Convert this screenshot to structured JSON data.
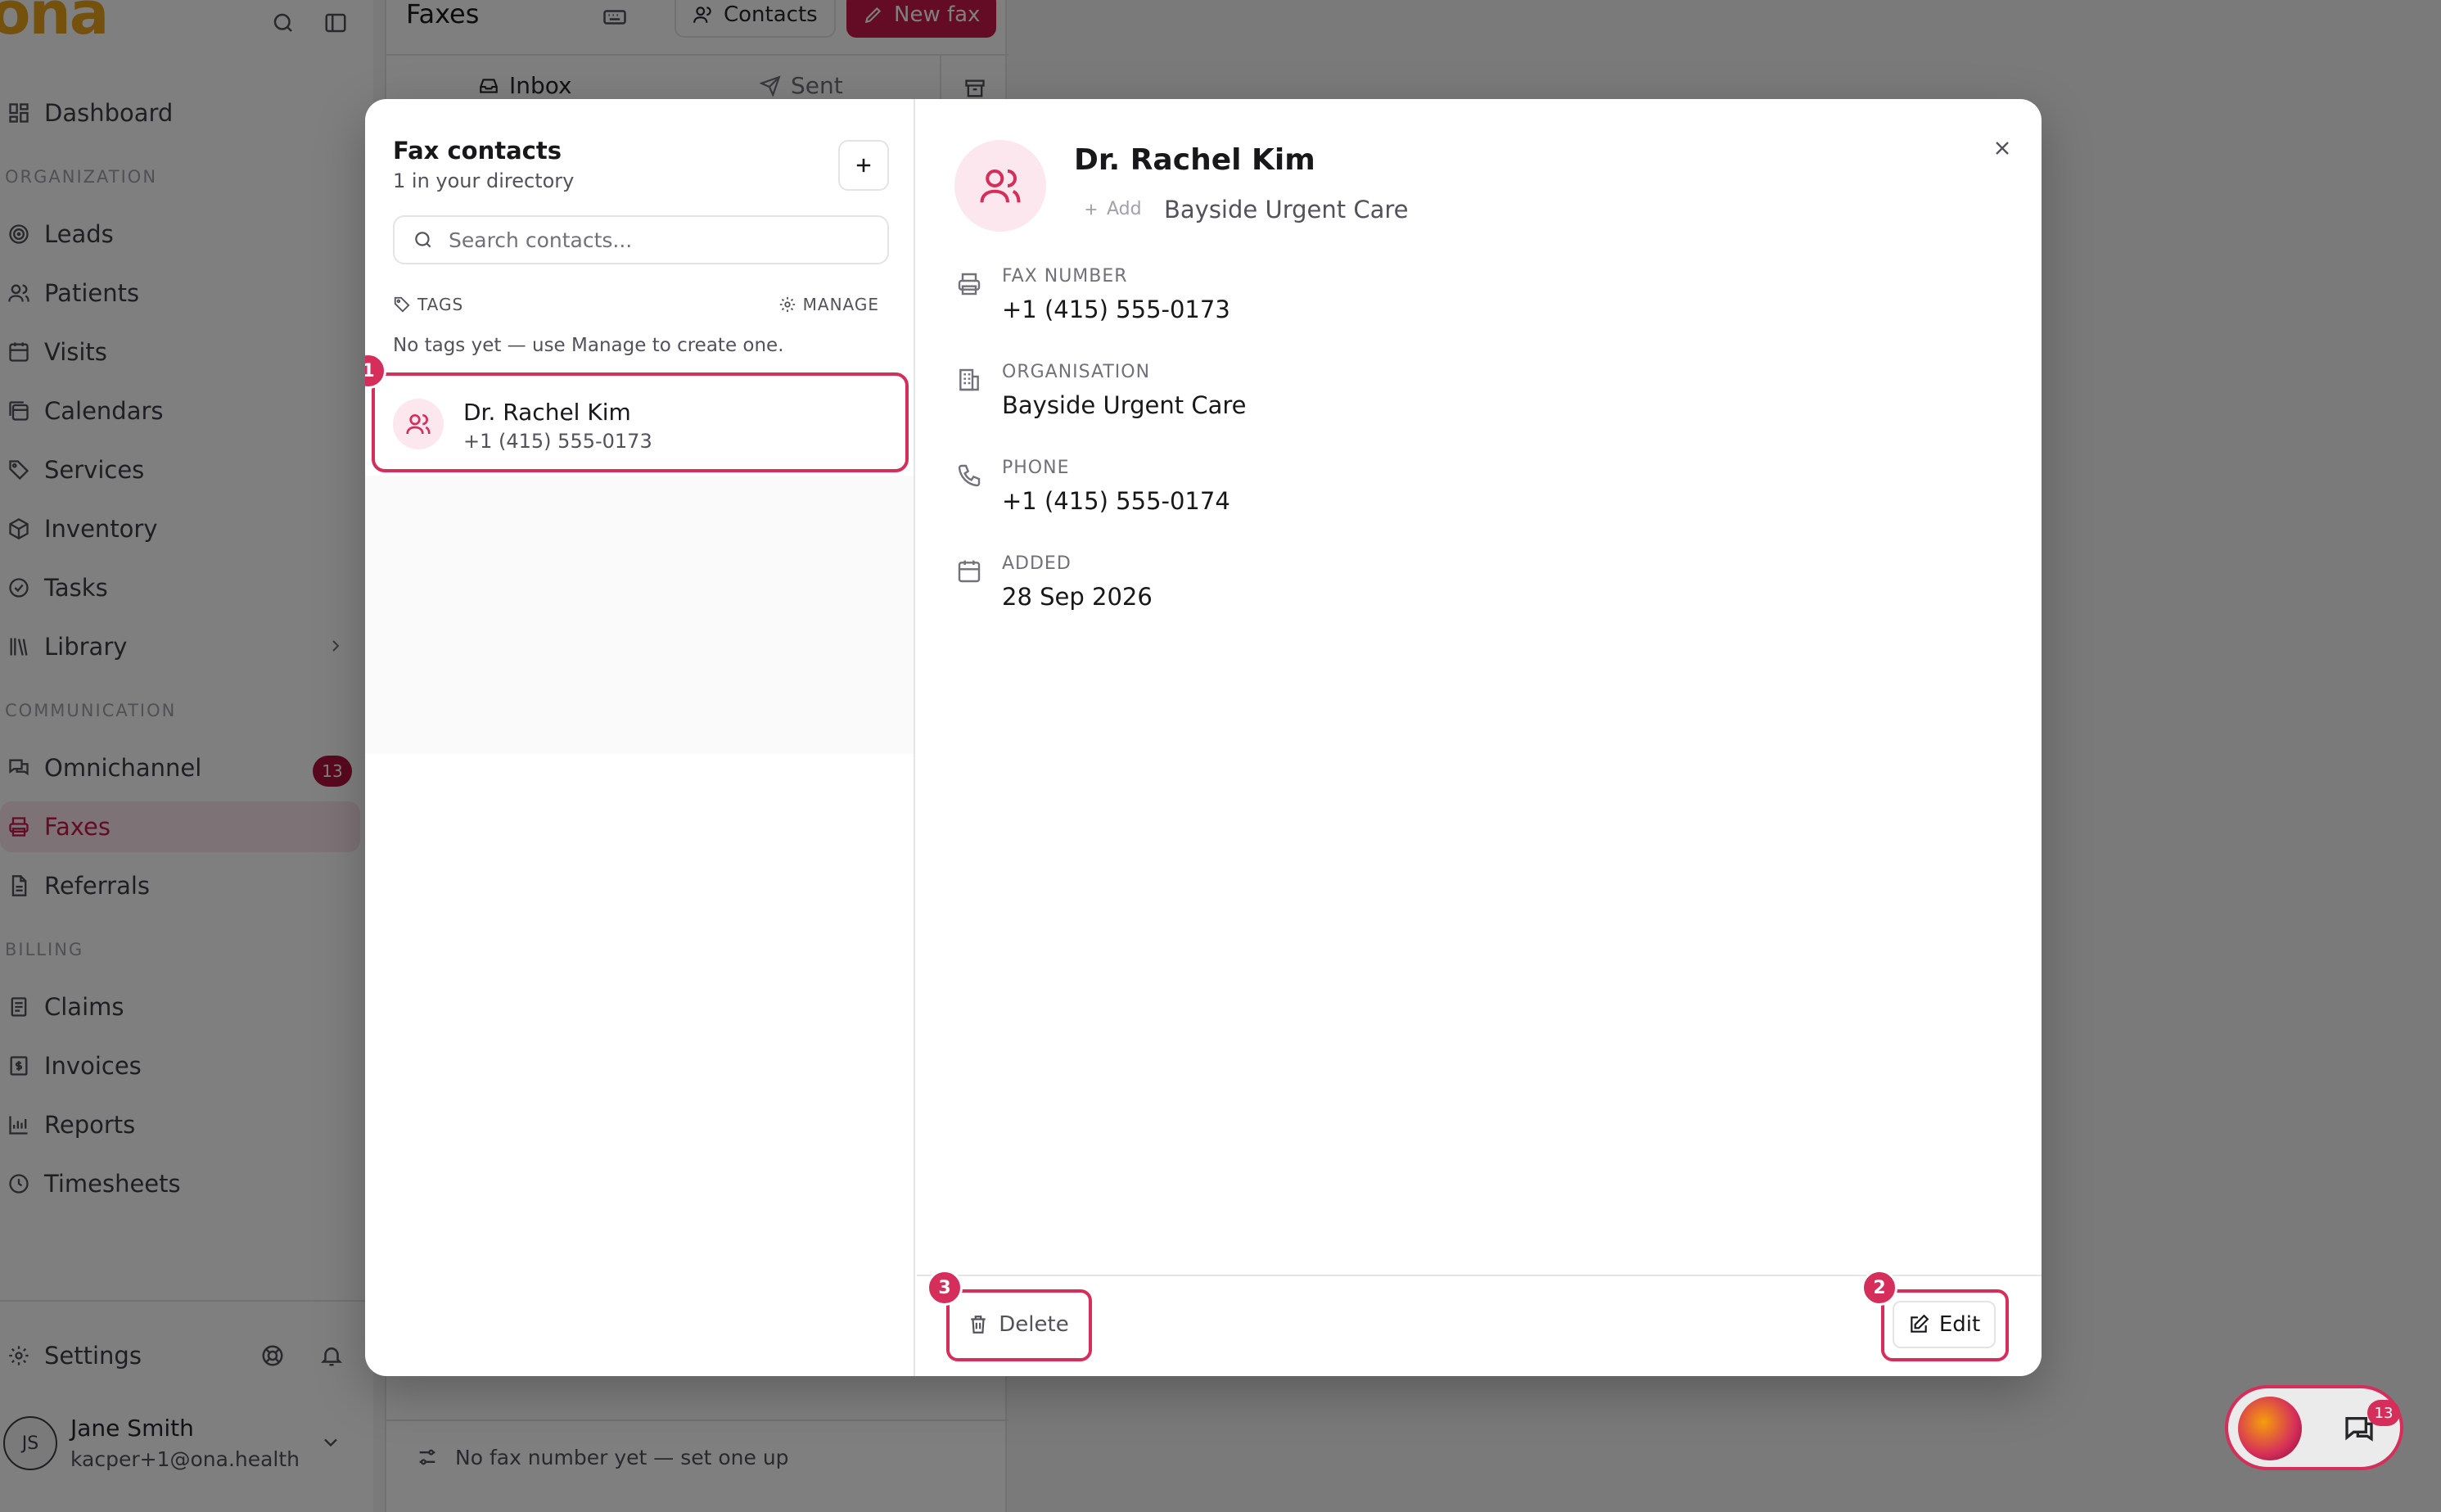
{
  "app": {
    "logo_text": "ona",
    "brand_color": "#c8184a",
    "logo_color": "#e8a21b"
  },
  "sidebar": {
    "top_nav": [
      {
        "id": "dashboard",
        "label": "Dashboard",
        "icon": "grid-icon"
      }
    ],
    "sections": [
      {
        "title": "ORGANIZATION",
        "items": [
          {
            "label": "Leads",
            "icon": "target-icon"
          },
          {
            "label": "Patients",
            "icon": "users-icon"
          },
          {
            "label": "Visits",
            "icon": "calendar-grid-icon"
          },
          {
            "label": "Calendars",
            "icon": "calendars-icon"
          },
          {
            "label": "Services",
            "icon": "tag-icon"
          },
          {
            "label": "Inventory",
            "icon": "box-icon"
          },
          {
            "label": "Tasks",
            "icon": "check-circle-icon"
          },
          {
            "label": "Library",
            "icon": "library-icon"
          }
        ]
      },
      {
        "title": "COMMUNICATION",
        "items": [
          {
            "label": "Omnichannel",
            "icon": "messages-icon",
            "badge": "13"
          },
          {
            "label": "Faxes",
            "icon": "printer-icon",
            "active": true
          },
          {
            "label": "Referrals",
            "icon": "document-icon"
          }
        ]
      },
      {
        "title": "BILLING",
        "items": [
          {
            "label": "Claims",
            "icon": "file-list-icon"
          },
          {
            "label": "Invoices",
            "icon": "invoice-icon"
          },
          {
            "label": "Reports",
            "icon": "chart-icon"
          },
          {
            "label": "Timesheets",
            "icon": "clock-icon"
          }
        ]
      }
    ],
    "settings_label": "Settings",
    "user": {
      "initials": "JS",
      "name": "Jane Smith",
      "email": "kacper+1@ona.health"
    }
  },
  "fax_page": {
    "title": "Faxes",
    "contacts_button": "Contacts",
    "new_fax_button": "New fax",
    "tabs": [
      {
        "label": "Inbox"
      },
      {
        "label": "Sent"
      }
    ],
    "footer_text": "No fax number yet — set one up"
  },
  "modal": {
    "title": "Fax contacts",
    "subtitle": "1 in your directory",
    "search_placeholder": "Search contacts...",
    "tags_label": "TAGS",
    "manage_label": "MANAGE",
    "empty_tags": "No tags yet — use Manage to create one.",
    "contacts": [
      {
        "name": "Dr. Rachel Kim",
        "phone": "+1 (415) 555-0173"
      }
    ],
    "detail": {
      "name": "Dr. Rachel Kim",
      "add_label": "Add",
      "organisation_tag": "Bayside Urgent Care",
      "fields": [
        {
          "label": "FAX NUMBER",
          "value": "+1 (415) 555-0173",
          "icon": "printer-icon"
        },
        {
          "label": "ORGANISATION",
          "value": "Bayside Urgent Care",
          "icon": "building-icon"
        },
        {
          "label": "PHONE",
          "value": "+1 (415) 555-0174",
          "icon": "phone-icon"
        },
        {
          "label": "ADDED",
          "value": "28 Sep 2026",
          "icon": "calendar-icon"
        }
      ],
      "delete_label": "Delete",
      "edit_label": "Edit"
    },
    "markers": {
      "contact": "1",
      "edit": "2",
      "delete": "3"
    }
  },
  "widget": {
    "badge": "13"
  }
}
